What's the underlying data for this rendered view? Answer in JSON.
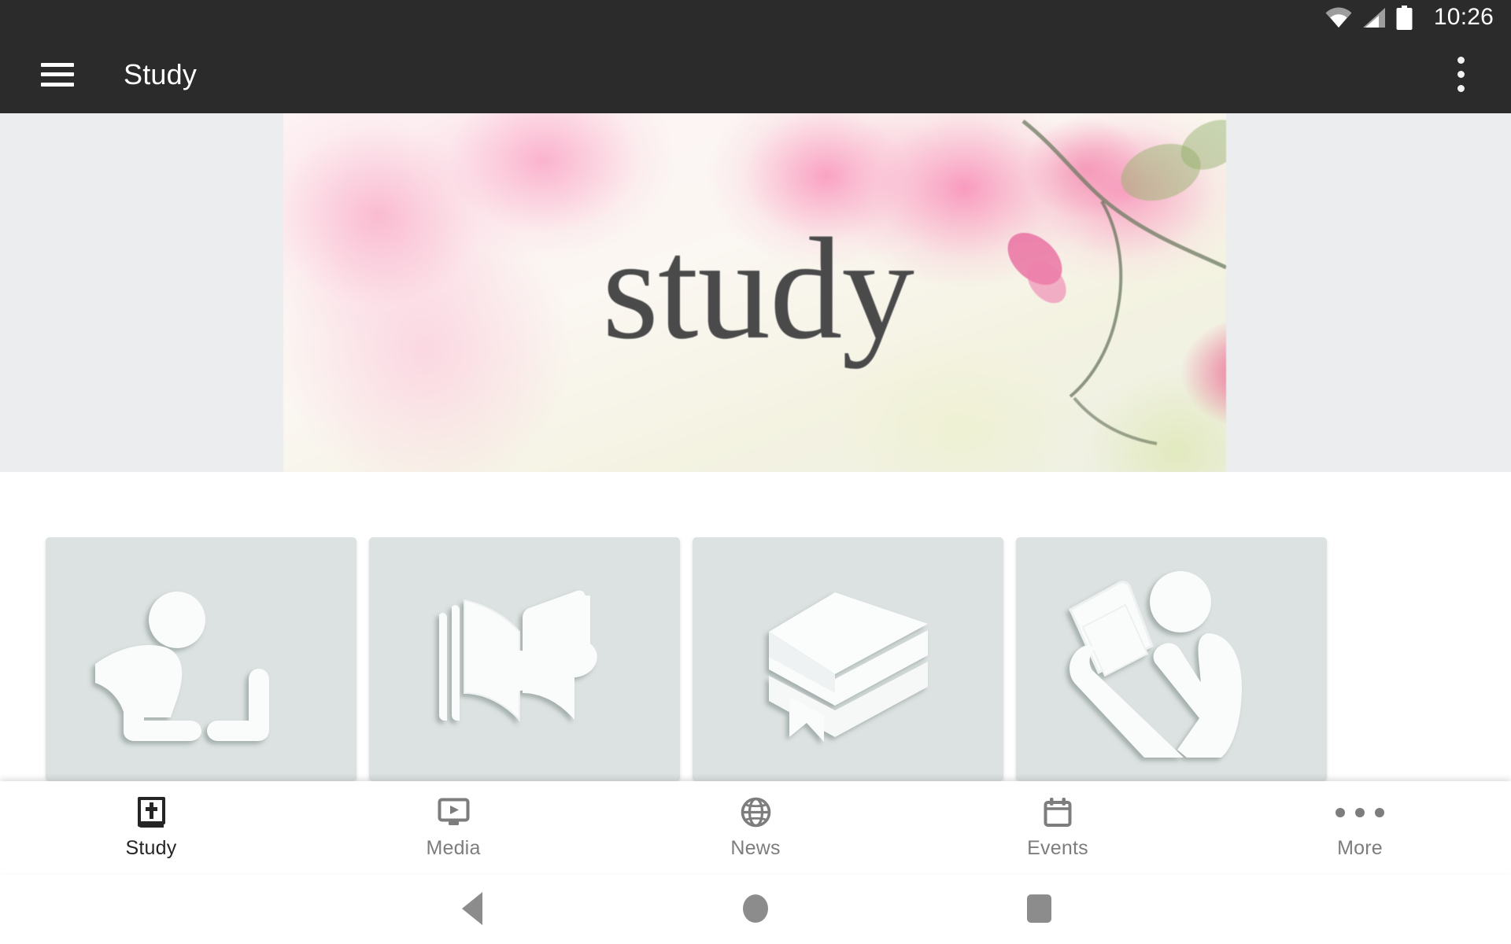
{
  "status_bar": {
    "time": "10:26",
    "icons": [
      "wifi-icon",
      "cellular-signal-icon",
      "battery-icon"
    ]
  },
  "app_bar": {
    "menu_icon": "hamburger-menu-icon",
    "title": "Study",
    "overflow_icon": "overflow-menu-icon",
    "background_color": "#2b2b2b"
  },
  "hero": {
    "banner_word": "study",
    "background_color": "#ebedee",
    "image_description": "pink cherry blossom branch photograph"
  },
  "cards": [
    {
      "icon": "person-kneeling-studying-icon",
      "bg": "#dce2e1"
    },
    {
      "icon": "songbook-music-note-icon",
      "bg": "#dce2e1"
    },
    {
      "icon": "stacked-books-icon",
      "bg": "#dce2e1"
    },
    {
      "icon": "person-sitting-reading-icon",
      "bg": "#dce2e1"
    }
  ],
  "bottom_nav": {
    "active_index": 0,
    "active_color": "#252525",
    "inactive_color": "#7d7d7d",
    "items": [
      {
        "label": "Study",
        "icon": "bible-book-cross-icon"
      },
      {
        "label": "Media",
        "icon": "monitor-play-icon"
      },
      {
        "label": "News",
        "icon": "globe-icon"
      },
      {
        "label": "Events",
        "icon": "calendar-icon"
      },
      {
        "label": "More",
        "icon": "ellipsis-icon"
      }
    ]
  },
  "android_nav": {
    "buttons": [
      {
        "name": "back",
        "icon": "back-triangle-icon"
      },
      {
        "name": "home",
        "icon": "home-circle-icon"
      },
      {
        "name": "recents",
        "icon": "recents-square-icon"
      }
    ]
  }
}
